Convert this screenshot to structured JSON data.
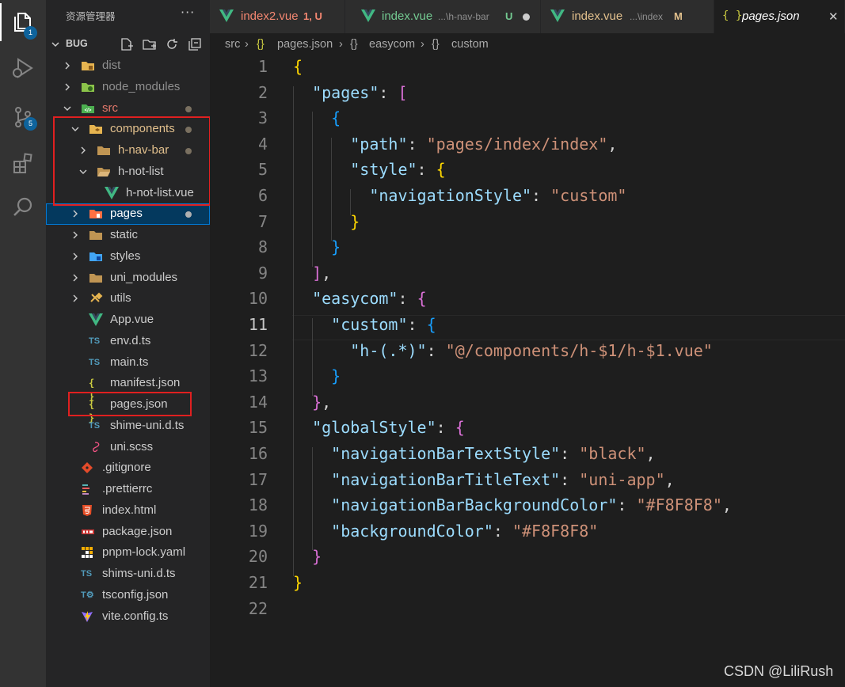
{
  "activity_bar": {
    "explorer_badge": "1",
    "scm_badge": "5"
  },
  "sidebar": {
    "title": "资源管理器",
    "more": "···",
    "root_label": "BUG",
    "tree": [
      {
        "label": "dist",
        "icon": "folder-dist-icon",
        "color": "#8f8f8f"
      },
      {
        "label": "node_modules",
        "icon": "folder-node-icon",
        "color": "#8f8f8f"
      },
      {
        "label": "src",
        "icon": "folder-src-icon",
        "color": "#e2776a"
      },
      {
        "label": "components",
        "icon": "folder-components-icon",
        "color": "#e2c08d"
      },
      {
        "label": "h-nav-bar",
        "icon": "folder-icon",
        "color": "#e2c08d"
      },
      {
        "label": "h-not-list",
        "icon": "folder-open-icon",
        "color": "#cccccc"
      },
      {
        "label": "h-not-list.vue",
        "icon": "vue-file-icon",
        "color": "#cccccc"
      },
      {
        "label": "pages",
        "icon": "folder-pages-icon",
        "color": "#ffffff"
      },
      {
        "label": "static",
        "icon": "folder-static-icon",
        "color": "#cccccc"
      },
      {
        "label": "styles",
        "icon": "folder-styles-icon",
        "color": "#cccccc"
      },
      {
        "label": "uni_modules",
        "icon": "folder-icon",
        "color": "#cccccc"
      },
      {
        "label": "utils",
        "icon": "folder-utils-icon",
        "color": "#cccccc"
      },
      {
        "label": "App.vue",
        "icon": "vue-file-icon",
        "color": "#cccccc"
      },
      {
        "label": "env.d.ts",
        "icon": "ts-file-icon",
        "color": "#cccccc"
      },
      {
        "label": "main.ts",
        "icon": "ts-file-icon",
        "color": "#cccccc"
      },
      {
        "label": "manifest.json",
        "icon": "json-file-icon",
        "color": "#cccccc"
      },
      {
        "label": "pages.json",
        "icon": "json-file-icon",
        "color": "#cccccc"
      },
      {
        "label": "shime-uni.d.ts",
        "icon": "ts-file-icon",
        "color": "#cccccc"
      },
      {
        "label": "uni.scss",
        "icon": "sass-file-icon",
        "color": "#cccccc"
      },
      {
        "label": ".gitignore",
        "icon": "git-file-icon",
        "color": "#cccccc"
      },
      {
        "label": ".prettierrc",
        "icon": "prettier-file-icon",
        "color": "#cccccc"
      },
      {
        "label": "index.html",
        "icon": "html-file-icon",
        "color": "#cccccc"
      },
      {
        "label": "package.json",
        "icon": "npm-file-icon",
        "color": "#cccccc"
      },
      {
        "label": "pnpm-lock.yaml",
        "icon": "pnpm-file-icon",
        "color": "#cccccc"
      },
      {
        "label": "shims-uni.d.ts",
        "icon": "ts-file-icon",
        "color": "#cccccc"
      },
      {
        "label": "tsconfig.json",
        "icon": "tsconfig-file-icon",
        "color": "#cccccc"
      },
      {
        "label": "vite.config.ts",
        "icon": "vite-file-icon",
        "color": "#cccccc"
      }
    ]
  },
  "tabs": [
    {
      "name": "index2.vue",
      "desc": "",
      "status": "1, U",
      "name_color": "#f48771",
      "status_color": "#f48771"
    },
    {
      "name": "index.vue",
      "desc": "...\\h-nav-bar",
      "status": "U",
      "name_color": "#73c991",
      "status_color": "#73c991"
    },
    {
      "name": "index.vue",
      "desc": "...\\index",
      "status": "M",
      "name_color": "#e2c08d",
      "status_color": "#e2c08d"
    },
    {
      "name": "pages.json",
      "desc": "",
      "status": "",
      "name_color": "#ffffff",
      "status_color": "#ffffff"
    }
  ],
  "tab_close": "✕",
  "breadcrumb": {
    "items": [
      "src",
      "pages.json",
      "easycom",
      "custom"
    ],
    "brace": "{}",
    "sep": "›"
  },
  "editor": {
    "current_line": 11,
    "lines": [
      [
        [
          "{",
          "b1"
        ]
      ],
      [
        [
          "  ",
          "p"
        ],
        [
          "\"pages\"",
          "k"
        ],
        [
          ": ",
          "p"
        ],
        [
          "[",
          "b2"
        ]
      ],
      [
        [
          "    ",
          "p"
        ],
        [
          "{",
          "b3"
        ]
      ],
      [
        [
          "      ",
          "p"
        ],
        [
          "\"path\"",
          "k"
        ],
        [
          ": ",
          "p"
        ],
        [
          "\"pages/index/index\"",
          "s"
        ],
        [
          ",",
          "p"
        ]
      ],
      [
        [
          "      ",
          "p"
        ],
        [
          "\"style\"",
          "k"
        ],
        [
          ": ",
          "p"
        ],
        [
          "{",
          "b1"
        ]
      ],
      [
        [
          "        ",
          "p"
        ],
        [
          "\"navigationStyle\"",
          "k"
        ],
        [
          ": ",
          "p"
        ],
        [
          "\"custom\"",
          "s"
        ]
      ],
      [
        [
          "      ",
          "p"
        ],
        [
          "}",
          "b1"
        ]
      ],
      [
        [
          "    ",
          "p"
        ],
        [
          "}",
          "b3"
        ]
      ],
      [
        [
          "  ",
          "p"
        ],
        [
          "]",
          "b2"
        ],
        [
          ",",
          "p"
        ]
      ],
      [
        [
          "  ",
          "p"
        ],
        [
          "\"easycom\"",
          "k"
        ],
        [
          ": ",
          "p"
        ],
        [
          "{",
          "b2"
        ]
      ],
      [
        [
          "    ",
          "p"
        ],
        [
          "\"custom\"",
          "k"
        ],
        [
          ": ",
          "p"
        ],
        [
          "{",
          "b3"
        ]
      ],
      [
        [
          "      ",
          "p"
        ],
        [
          "\"h-(.*)\"",
          "k"
        ],
        [
          ": ",
          "p"
        ],
        [
          "\"@/components/h-$1/h-$1.vue\"",
          "s"
        ]
      ],
      [
        [
          "    ",
          "p"
        ],
        [
          "}",
          "b3"
        ]
      ],
      [
        [
          "  ",
          "p"
        ],
        [
          "}",
          "b2"
        ],
        [
          ",",
          "p"
        ]
      ],
      [
        [
          "  ",
          "p"
        ],
        [
          "\"globalStyle\"",
          "k"
        ],
        [
          ": ",
          "p"
        ],
        [
          "{",
          "b2"
        ]
      ],
      [
        [
          "    ",
          "p"
        ],
        [
          "\"navigationBarTextStyle\"",
          "k"
        ],
        [
          ": ",
          "p"
        ],
        [
          "\"black\"",
          "s"
        ],
        [
          ",",
          "p"
        ]
      ],
      [
        [
          "    ",
          "p"
        ],
        [
          "\"navigationBarTitleText\"",
          "k"
        ],
        [
          ": ",
          "p"
        ],
        [
          "\"uni-app\"",
          "s"
        ],
        [
          ",",
          "p"
        ]
      ],
      [
        [
          "    ",
          "p"
        ],
        [
          "\"navigationBarBackgroundColor\"",
          "k"
        ],
        [
          ": ",
          "p"
        ],
        [
          "\"#F8F8F8\"",
          "s"
        ],
        [
          ",",
          "p"
        ]
      ],
      [
        [
          "    ",
          "p"
        ],
        [
          "\"backgroundColor\"",
          "k"
        ],
        [
          ": ",
          "p"
        ],
        [
          "\"#F8F8F8\"",
          "s"
        ]
      ],
      [
        [
          "  ",
          "p"
        ],
        [
          "}",
          "b2"
        ]
      ],
      [
        [
          "}",
          "b1"
        ]
      ],
      []
    ]
  },
  "watermark": "CSDN @LiliRush"
}
